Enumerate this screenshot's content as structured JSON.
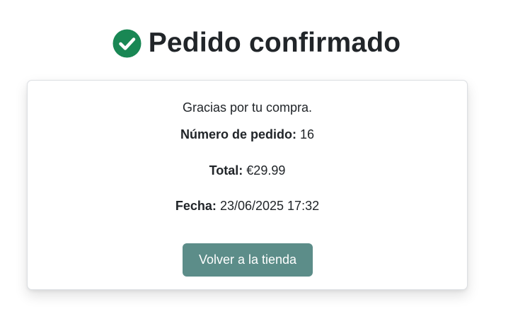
{
  "header": {
    "title": "Pedido confirmado",
    "icon": "check-circle-icon",
    "icon_color": "#198754"
  },
  "card": {
    "thanks": "Gracias por tu compra.",
    "order_label": "Número de pedido:",
    "order_value": "16",
    "total_label": "Total:",
    "total_value": "€29.99",
    "date_label": "Fecha:",
    "date_value": "23/06/2025 17:32",
    "button_label": "Volver a la tienda",
    "button_color": "#5c8d89"
  }
}
